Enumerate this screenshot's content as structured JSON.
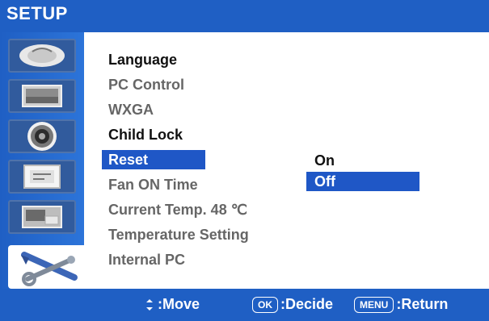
{
  "app": {
    "title": "SETUP"
  },
  "menu": {
    "items": [
      {
        "label": "Language"
      },
      {
        "label": "PC Control"
      },
      {
        "label": "WXGA"
      },
      {
        "label": "Child Lock"
      },
      {
        "label": "Reset",
        "selected": true
      },
      {
        "label": "Fan ON Time"
      },
      {
        "label": "Current Temp. 48 ℃"
      },
      {
        "label": "Temperature Setting"
      },
      {
        "label": "Internal PC"
      }
    ]
  },
  "submenu": {
    "options": [
      {
        "label": "On"
      },
      {
        "label": "Off",
        "selected": true
      }
    ]
  },
  "footer": {
    "move_label": ":Move",
    "ok_key": "OK",
    "decide_label": ":Decide",
    "menu_key": "MENU",
    "return_label": ":Return"
  },
  "colors": {
    "header_blue": "#1f5fc4",
    "selection_blue": "#1f57c6",
    "footer_blue": "#1f5fc4"
  },
  "icons": {
    "rail": [
      "picture-icon",
      "screen-icon",
      "speaker-icon",
      "clock-icon",
      "pip-icon",
      "setup-tools-icon"
    ]
  }
}
